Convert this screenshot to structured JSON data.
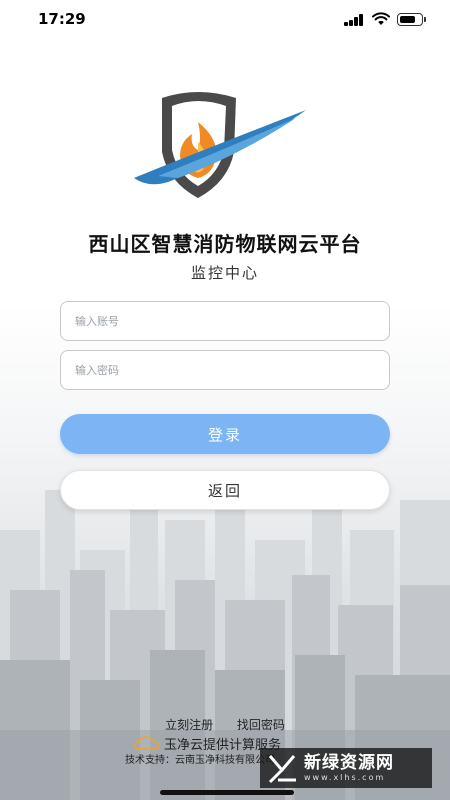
{
  "status_bar": {
    "time": "17:29",
    "battery_level": 0.75,
    "signal_bars": 4
  },
  "app": {
    "title": "西山区智慧消防物联网云平台",
    "subtitle": "监控中心"
  },
  "form": {
    "account_placeholder": "输入账号",
    "password_placeholder": "输入密码",
    "login_label": "登录",
    "back_label": "返回"
  },
  "footer": {
    "register_link": "立刻注册",
    "recover_link": "找回密码",
    "provider_text": "玉净云提供计算服务",
    "support_text": "技术支持：云南玉净科技有限公司"
  },
  "watermark": {
    "main": "新绿资源网",
    "sub": "www.xlhs.com"
  },
  "colors": {
    "login_button": "#7db4f3",
    "logo_blue": "#2f7fc0",
    "flame_orange": "#f08a24"
  },
  "icons": {
    "logo": "shield-flame-logo",
    "provider": "cloud-icon"
  }
}
